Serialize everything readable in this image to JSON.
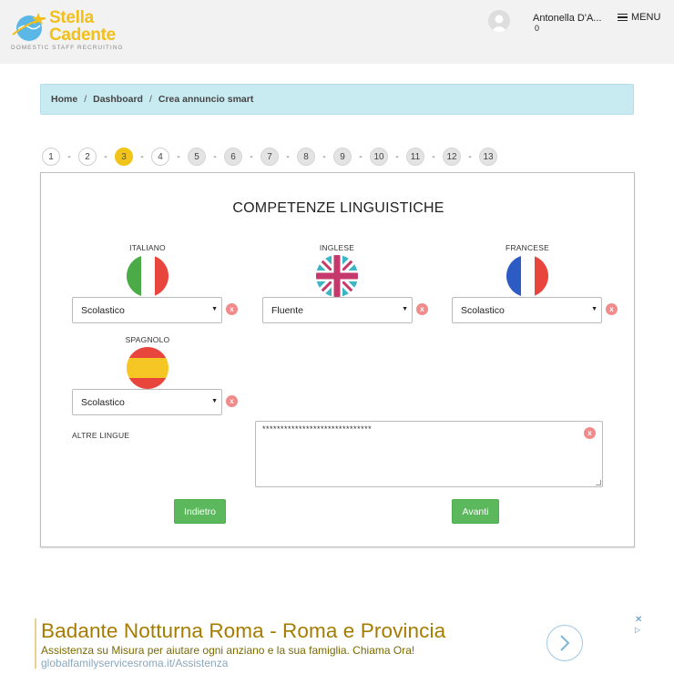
{
  "header": {
    "logo_line1": "Stella",
    "logo_line2": "Cadente",
    "logo_tagline": "DOMESTIC STAFF RECRUITING",
    "user_name": "Antonella D'A...",
    "user_count": "0",
    "menu_label": "MENU"
  },
  "breadcrumb": {
    "items": [
      "Home",
      "Dashboard",
      "Crea annuncio smart"
    ],
    "separator": "/"
  },
  "steps": {
    "labels": [
      "1",
      "2",
      "3",
      "4",
      "5",
      "6",
      "7",
      "8",
      "9",
      "10",
      "11",
      "12",
      "13"
    ],
    "current": 3,
    "separator": "-"
  },
  "form": {
    "title": "COMPETENZE LINGUISTICHE",
    "languages": [
      {
        "label": "ITALIANO",
        "level": "Scolastico",
        "flag_icon": "italy-flag-icon"
      },
      {
        "label": "INGLESE",
        "level": "Fluente",
        "flag_icon": "uk-flag-icon"
      },
      {
        "label": "FRANCESE",
        "level": "Scolastico",
        "flag_icon": "france-flag-icon"
      },
      {
        "label": "SPAGNOLO",
        "level": "Scolastico",
        "flag_icon": "spain-flag-icon"
      }
    ],
    "clear_label": "x",
    "other_languages_label": "ALTRE LINGUE",
    "other_languages_value": "******************************",
    "back_button": "Indietro",
    "next_button": "Avanti"
  },
  "ad": {
    "title": "Badante Notturna Roma - Roma e Provincia",
    "description": "Assistenza su Misura per aiutare ogni anziano e la sua famiglia. Chiama Ora!",
    "url": "globalfamilyservicesroma.it/Assistenza",
    "close_label": "✕",
    "info_label": "▷"
  },
  "colors": {
    "brand_yellow": "#f2bf1b",
    "breadcrumb_bg": "#c8ebf2",
    "active_step": "#f0c419",
    "button_green": "#5cb85c",
    "clear_red": "#f08b8b"
  }
}
